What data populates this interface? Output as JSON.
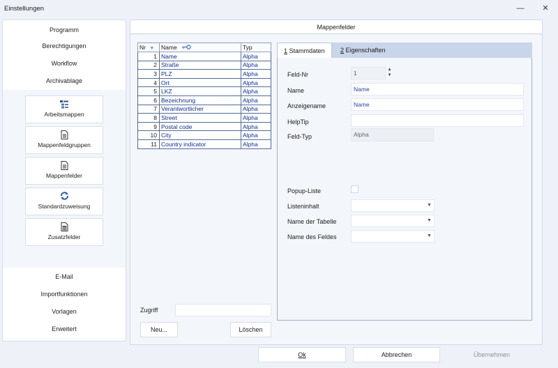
{
  "window": {
    "title": "Einstellungen",
    "minimize": "—",
    "close": "✕"
  },
  "sidebar": {
    "top_items": [
      "Programm",
      "Berechtigungen",
      "Workflow",
      "Archivablage"
    ],
    "icon_buttons": [
      {
        "label": "Arbeitsmappen",
        "icon": "workbooks-icon"
      },
      {
        "label": "Mappenfeldgruppen",
        "icon": "document-icon"
      },
      {
        "label": "Mappenfelder",
        "icon": "document-icon"
      },
      {
        "label": "Standardzuweisung",
        "icon": "refresh-icon"
      },
      {
        "label": "Zusatzfelder",
        "icon": "document-list-icon"
      }
    ],
    "bottom_items": [
      "E-Mail",
      "Importfunktionen",
      "Vorlagen",
      "Erweitert"
    ]
  },
  "main": {
    "header": "Mappenfelder",
    "grid": {
      "columns": [
        "Nr",
        "Name",
        "Typ"
      ],
      "rows": [
        {
          "nr": "1",
          "name": "Name",
          "typ": "Alpha"
        },
        {
          "nr": "2",
          "name": "Straße",
          "typ": "Alpha"
        },
        {
          "nr": "3",
          "name": "PLZ",
          "typ": "Alpha"
        },
        {
          "nr": "4",
          "name": "Ort",
          "typ": "Alpha"
        },
        {
          "nr": "5",
          "name": "LKZ",
          "typ": "Alpha"
        },
        {
          "nr": "6",
          "name": "Bezeichnung",
          "typ": "Alpha"
        },
        {
          "nr": "7",
          "name": "Verantwortlicher",
          "typ": "Alpha"
        },
        {
          "nr": "8",
          "name": "Street",
          "typ": "Alpha"
        },
        {
          "nr": "9",
          "name": "Postal code",
          "typ": "Alpha"
        },
        {
          "nr": "10",
          "name": "City",
          "typ": "Alpha"
        },
        {
          "nr": "11",
          "name": "Country indicator",
          "typ": "Alpha"
        }
      ]
    },
    "zugriff_label": "Zugriff",
    "zugriff_value": "",
    "new_button": "Neu...",
    "delete_button": "Löschen",
    "tabs": [
      {
        "key": "1",
        "label": " Stammdaten"
      },
      {
        "key": "2",
        "label": " Eigenschaften"
      }
    ],
    "form": {
      "feld_nr_label": "Feld-Nr",
      "feld_nr_value": "1",
      "name_label": "Name",
      "name_value": "Name",
      "anzeigename_label": "Anzeigename",
      "anzeigename_value": "Name",
      "helptip_label": "HelpTip",
      "helptip_value": "",
      "feldtyp_label": "Feld-Typ",
      "feldtyp_value": "Alpha",
      "popup_label": "Popup-Liste",
      "listeninhalt_label": "Listeninhalt",
      "tabelle_label": "Name der Tabelle",
      "feld_label": "Name des Feldes"
    }
  },
  "footer": {
    "ok": "Ok",
    "cancel": "Abbrechen",
    "apply": "Übernehmen"
  },
  "colors": {
    "accent": "#0e2e8c",
    "tab_strip": "#c9d5ea",
    "background": "#eef2f8"
  }
}
